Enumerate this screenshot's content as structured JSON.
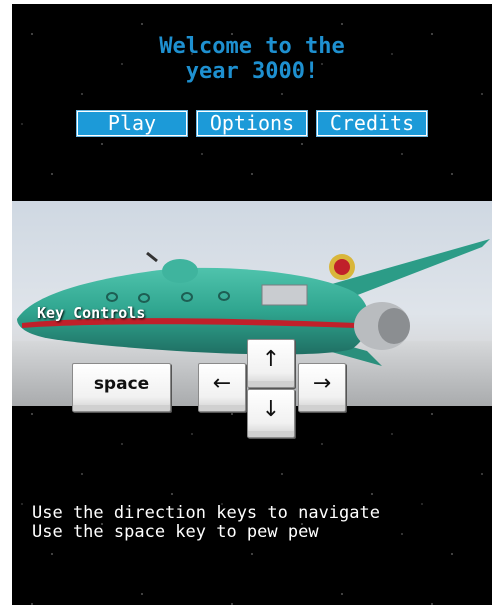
{
  "title": {
    "line1": "Welcome to the",
    "line2": "year 3000!"
  },
  "menu": {
    "play": "Play",
    "options": "Options",
    "credits": "Credits"
  },
  "controls": {
    "heading": "Key Controls",
    "space_key": "space",
    "up_key": "↑",
    "down_key": "↓",
    "left_key": "←",
    "right_key": "→"
  },
  "instructions": {
    "line1": "Use the direction keys to navigate",
    "line2": "Use the space key to pew pew"
  },
  "colors": {
    "title": "#1e90d0",
    "button": "#1c9ad8",
    "background": "#000000",
    "ship_hull": "#2fa58f",
    "ship_stripe": "#c0202a"
  },
  "scene": {
    "depicts": "planet-express-ship"
  }
}
